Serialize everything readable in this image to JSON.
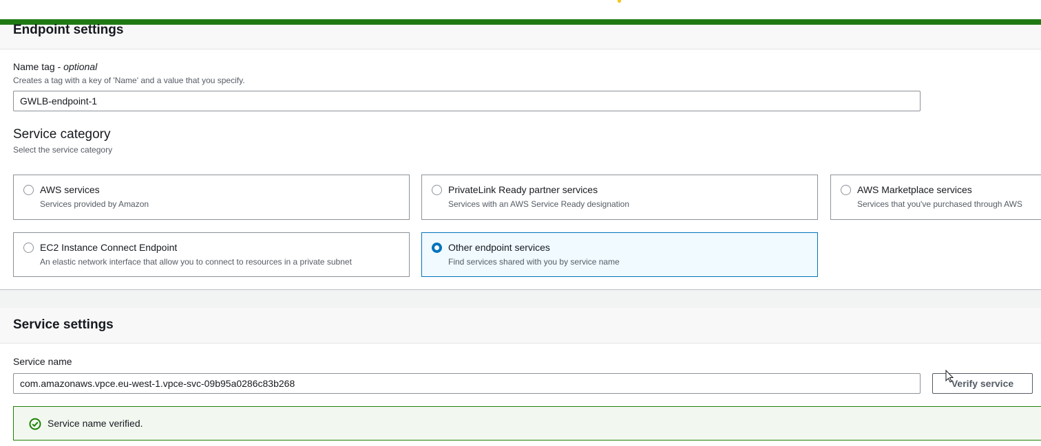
{
  "endpoint_settings": {
    "title": "Endpoint settings",
    "name_tag": {
      "label": "Name tag",
      "label_suffix": "optional",
      "description": "Creates a tag with a key of 'Name' and a value that you specify.",
      "value": "GWLB-endpoint-1"
    },
    "service_category": {
      "title": "Service category",
      "description": "Select the service category",
      "options": [
        {
          "title": "AWS services",
          "description": "Services provided by Amazon",
          "selected": false
        },
        {
          "title": "PrivateLink Ready partner services",
          "description": "Services with an AWS Service Ready designation",
          "selected": false
        },
        {
          "title": "AWS Marketplace services",
          "description": "Services that you've purchased through AWS",
          "selected": false
        },
        {
          "title": "EC2 Instance Connect Endpoint",
          "description": "An elastic network interface that allow you to connect to resources in a private subnet",
          "selected": false
        },
        {
          "title": "Other endpoint services",
          "description": "Find services shared with you by service name",
          "selected": true
        }
      ]
    }
  },
  "service_settings": {
    "title": "Service settings",
    "service_name": {
      "label": "Service name",
      "value": "com.amazonaws.vpce.eu-west-1.vpce-svc-09b95a0286c83b268"
    },
    "verify_button": "Verify service",
    "verified_message": "Service name verified."
  },
  "colors": {
    "accent_bar": "#1f7a14",
    "selected_border": "#0073bb",
    "success": "#1d8102"
  },
  "icons": [
    "radio-icon",
    "check-circle-icon",
    "mouse-cursor-icon"
  ]
}
